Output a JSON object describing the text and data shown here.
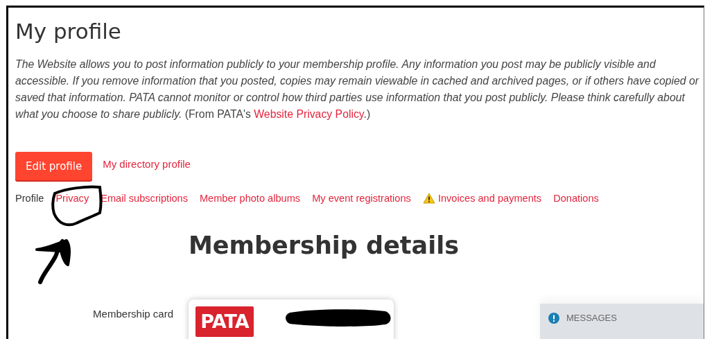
{
  "page": {
    "title": "My profile"
  },
  "intro": {
    "text": "*The Website allows you to post information publicly to your membership profile. Any information you post may be publicly visible and accessible. If you remove information that you posted, copies may remain viewable in cached and archived pages, or if others have copied or saved that information. PATA cannot monitor or control how third parties use information that you post publicly. Please think carefully about what you choose to share publicly.* (From PATA's ",
    "link": "Website Privacy Policy",
    "closing": ".)"
  },
  "actions": {
    "button": "Edit profile",
    "link": "My directory profile"
  },
  "tabs": [
    {
      "label": "Profile",
      "selected": true,
      "kind": "plain"
    },
    {
      "label": "Privacy",
      "selected": false,
      "kind": "plain"
    },
    {
      "label": "Email subscriptions",
      "selected": false,
      "kind": "plain"
    },
    {
      "label": "Member photo albums",
      "selected": false,
      "kind": "plain"
    },
    {
      "label": "My event registrations",
      "selected": false,
      "kind": "plain"
    },
    {
      "label": "Invoices and payments",
      "selected": false,
      "kind": "warning"
    },
    {
      "label": "Donations",
      "selected": false,
      "kind": "plain"
    }
  ],
  "membership": {
    "heading": "Membership details",
    "card_label": "Membership card",
    "card_logo": "PATA"
  },
  "messages": {
    "title": "MESSAGES"
  }
}
